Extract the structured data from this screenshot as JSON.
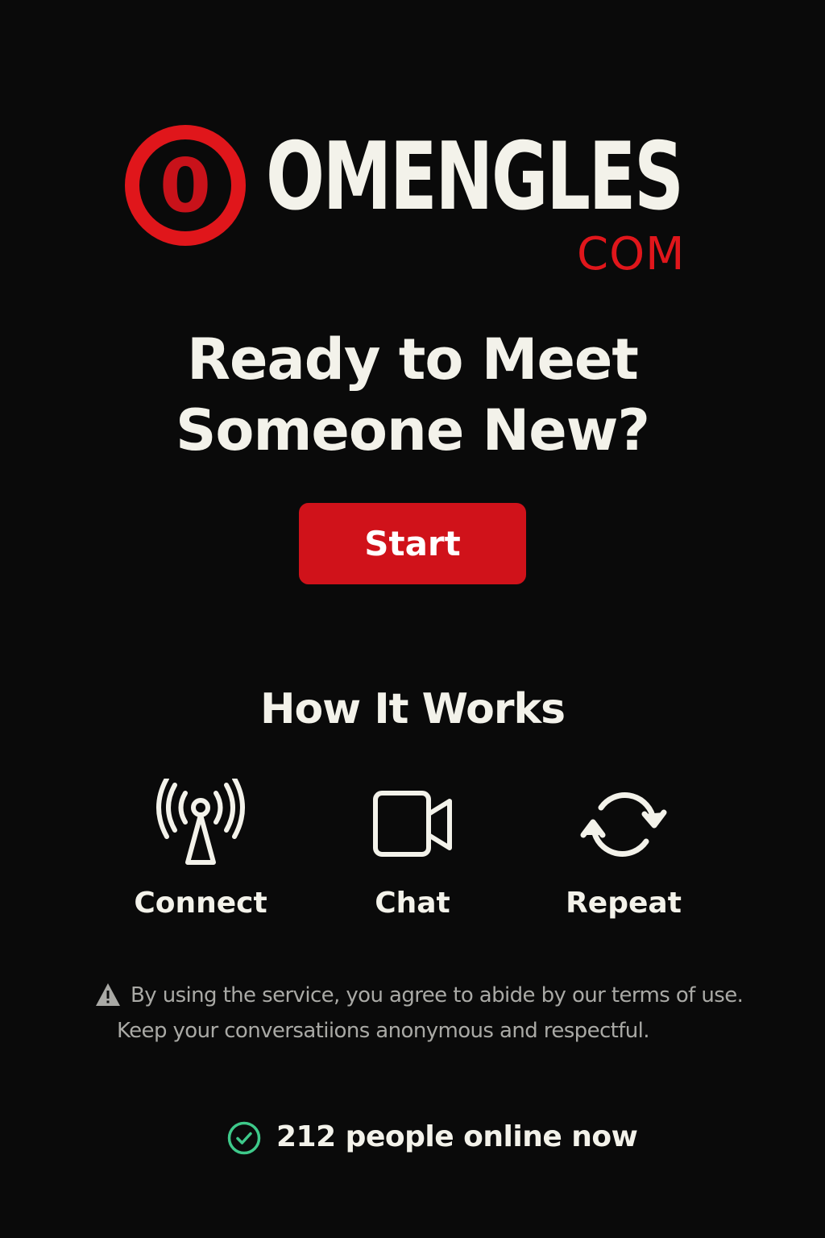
{
  "brand": {
    "badge_letter": "0",
    "name": "OMENGLES",
    "tld": "COM"
  },
  "hero": {
    "headline_line1": "Ready to Meet",
    "headline_line2": "Someone New?",
    "start_label": "Start"
  },
  "how_it_works": {
    "title": "How It Works",
    "steps": [
      {
        "label": "Connect",
        "icon": "antenna-icon"
      },
      {
        "label": "Chat",
        "icon": "video-camera-icon"
      },
      {
        "label": "Repeat",
        "icon": "refresh-icon"
      }
    ]
  },
  "terms": {
    "icon": "warning-icon",
    "line1": "By using the service, you agree to abide by our terms of use.",
    "line2": "Keep your conversatiions anonymous and respectful."
  },
  "status": {
    "icon": "check-circle-icon",
    "online_text": "212 people online now"
  },
  "colors": {
    "background": "#0a0a0a",
    "brand_red": "#e0161b",
    "button_red": "#d0121a",
    "text_primary": "#f3f2ea",
    "text_muted": "#a9a9a5",
    "online_green": "#3ec98a"
  }
}
